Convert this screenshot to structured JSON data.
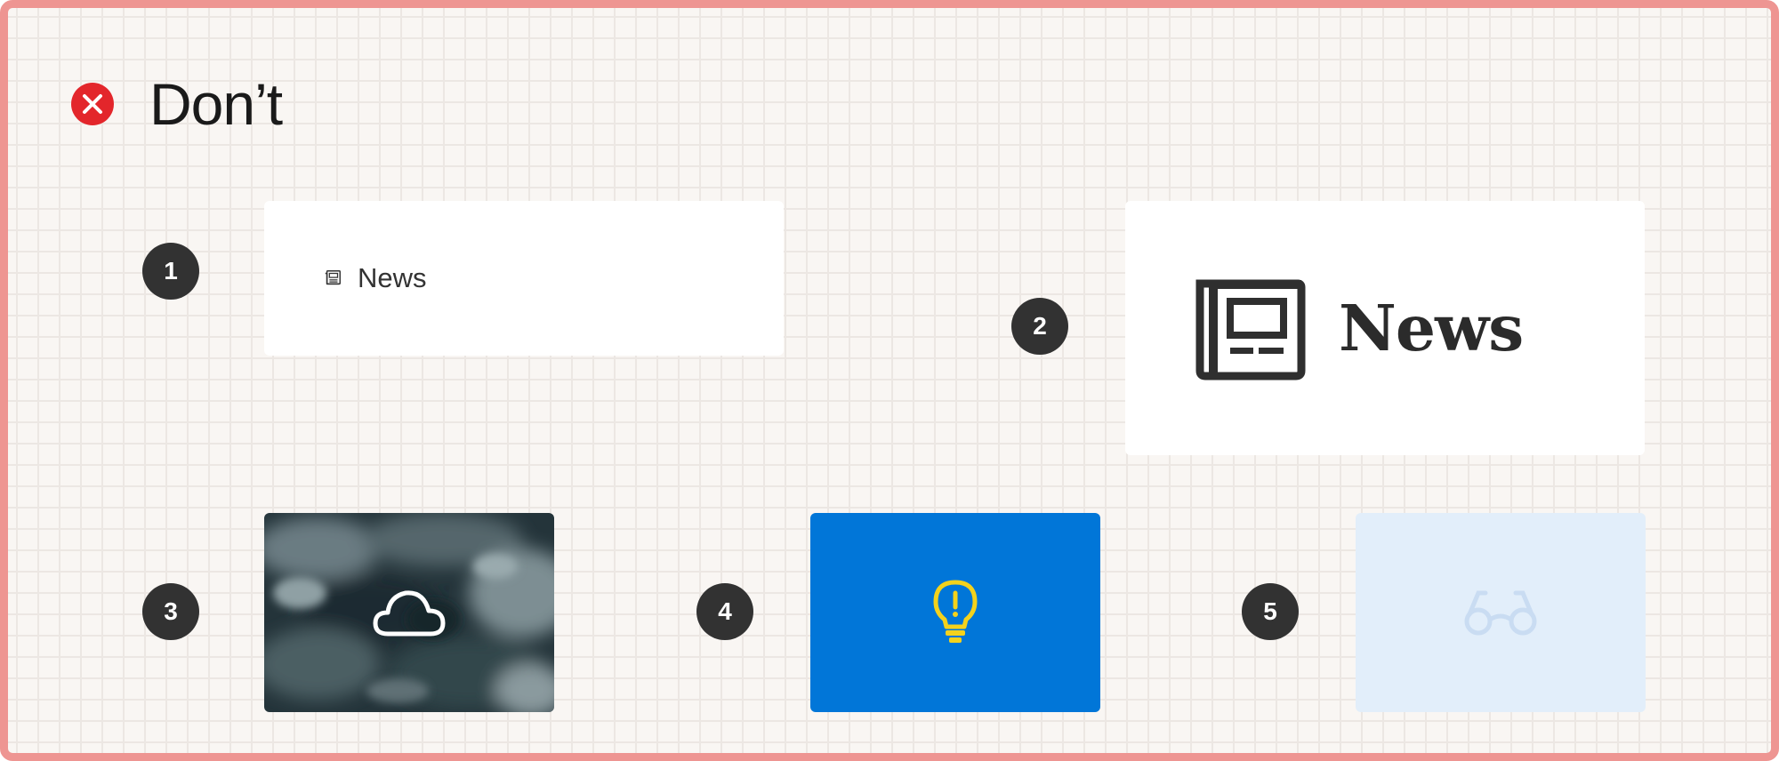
{
  "header": {
    "title": "Don’t",
    "status_icon": "close-circle-icon",
    "status_color": "#e3262b"
  },
  "frame": {
    "border_color": "#ee9592",
    "background": "#f9f6f3"
  },
  "examples": [
    {
      "number": "1",
      "label": "News",
      "icon": "newspaper-icon"
    },
    {
      "number": "2",
      "label": "News",
      "icon": "newspaper-icon"
    },
    {
      "number": "3",
      "icon": "cloud-icon",
      "background": "storm-clouds-photo"
    },
    {
      "number": "4",
      "icon": "lightbulb-icon",
      "background_color": "#0176d8",
      "icon_color": "#f4d21c"
    },
    {
      "number": "5",
      "icon": "glasses-icon",
      "background_color": "#e2eefa",
      "icon_color": "#c9dcf2"
    }
  ]
}
